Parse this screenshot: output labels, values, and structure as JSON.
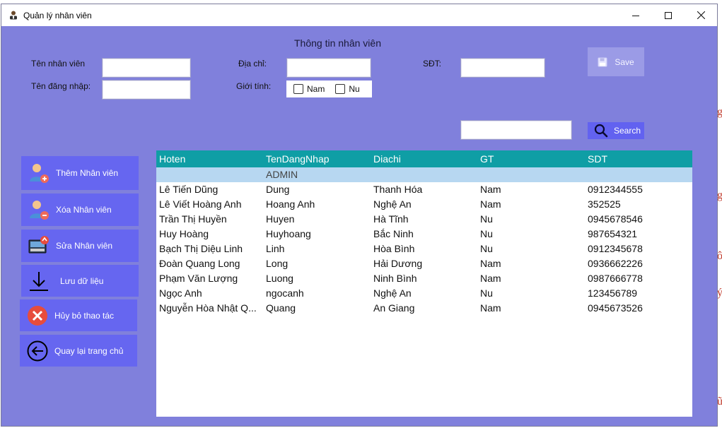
{
  "window": {
    "title": "Quản lý nhân viên"
  },
  "form": {
    "heading": "Thông tin nhân viên",
    "name_label": "Tên nhân viên",
    "name_value": "",
    "username_label": "Tên đăng nhập:",
    "username_value": "",
    "address_label": "Địa chỉ:",
    "address_value": "",
    "gender_label": "Giới tính:",
    "gender_male": "Nam",
    "gender_female": "Nu",
    "phone_label": "SĐT:",
    "phone_value": "",
    "save_label": "Save",
    "search_value": "",
    "search_label": "Search"
  },
  "actions": [
    {
      "label": "Thêm Nhân viên",
      "icon": "add-user-icon"
    },
    {
      "label": "Xóa Nhân viên",
      "icon": "remove-user-icon"
    },
    {
      "label": "Sửa Nhân viên",
      "icon": "edit-user-icon"
    },
    {
      "label": "Lưu dữ liệu",
      "icon": "download-icon"
    },
    {
      "label": "Hủy bỏ thao tác",
      "icon": "cancel-icon"
    },
    {
      "label": "Quay lại trang chủ",
      "icon": "back-icon"
    }
  ],
  "grid": {
    "columns": [
      "Hoten",
      "TenDangNhap",
      "Diachi",
      "GT",
      "SDT"
    ],
    "rows": [
      [
        "",
        "ADMIN",
        "",
        "",
        ""
      ],
      [
        "Lê Tiến Dũng",
        "Dung",
        "Thanh Hóa",
        "Nam",
        "0912344555"
      ],
      [
        "Lê Viết Hoàng Anh",
        "Hoang Anh",
        "Nghệ An",
        "Nam",
        "352525"
      ],
      [
        "Trần Thị Huyền",
        "Huyen",
        "Hà Tĩnh",
        "Nu",
        "0945678546"
      ],
      [
        "Huy Hoàng",
        "Huyhoang",
        "Bắc Ninh",
        "Nu",
        "987654321"
      ],
      [
        "Bạch Thị Diệu Linh",
        "Linh",
        "Hòa Bình",
        "Nu",
        "0912345678"
      ],
      [
        "Đoàn Quang Long",
        "Long",
        "Hải Dương",
        "Nam",
        "0936662226"
      ],
      [
        "Phạm Văn Lượng",
        "Luong",
        "Ninh Bình",
        "Nam",
        "0987666778"
      ],
      [
        "Ngọc Anh",
        "ngocanh",
        "Nghệ An",
        "Nu",
        "123456789"
      ],
      [
        "Nguyễn Hòa Nhật Q...",
        "Quang",
        "An Giang",
        "Nam",
        "0945673526"
      ]
    ]
  },
  "colors": {
    "window_bg": "#8080dc",
    "action_button": "#6666f0",
    "grid_header": "#0f9ea5",
    "selected_row": "#b7d7f1"
  }
}
